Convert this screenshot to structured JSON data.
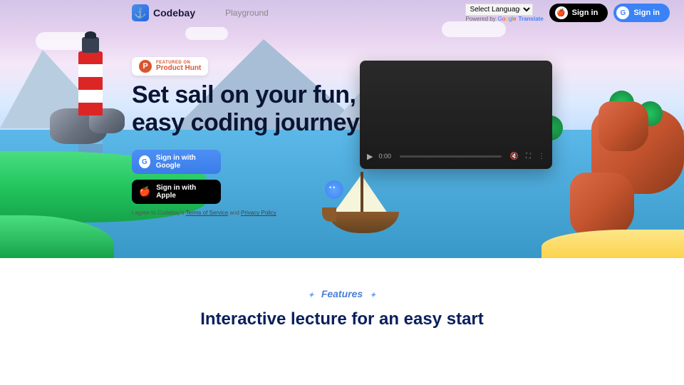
{
  "header": {
    "brand": "Codebay",
    "nav_playground": "Playground",
    "lang_selected": "Select Language",
    "powered_by": "Powered by",
    "translate_label": "Translate",
    "signin_apple": "Sign in",
    "signin_google": "Sign in"
  },
  "hero": {
    "ph_featured": "FEATURED ON",
    "ph_name": "Product Hunt",
    "headline_l1": "Set sail on your fun,",
    "headline_l2": "easy coding journey!",
    "btn_google": "Sign in with Google",
    "btn_apple": "Sign in with Apple",
    "terms_prefix": "I agree to Codebay's ",
    "terms_link": "Terms of Service",
    "terms_and": " and ",
    "privacy_link": "Privacy Policy",
    "video_time": "0:00"
  },
  "features": {
    "label": "Features",
    "heading": "Interactive lecture for an easy start"
  }
}
